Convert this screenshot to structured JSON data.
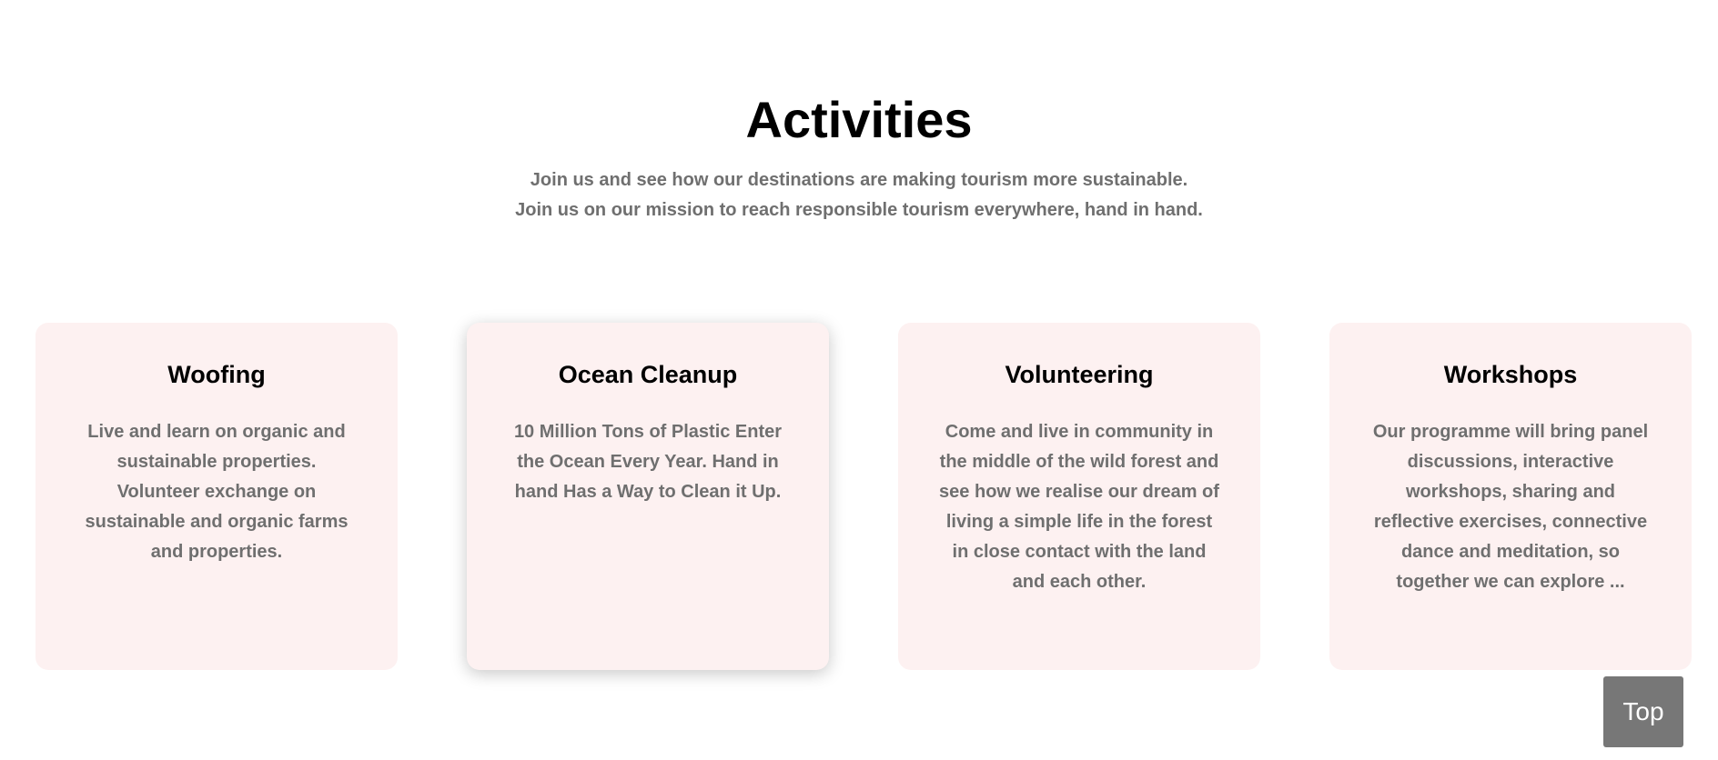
{
  "section": {
    "title": "Activities",
    "subtitle_line1": "Join us and see how our destinations are making tourism more sustainable.",
    "subtitle_line2": "Join us on our mission to reach responsible tourism everywhere, hand in hand."
  },
  "cards": [
    {
      "title": "Woofing",
      "text": "Live and learn on organic and sustainable properties. Volunteer exchange on sustainable and organic farms and properties."
    },
    {
      "title": "Ocean Cleanup",
      "text": "10 Million Tons of Plastic Enter the Ocean Every Year. Hand in hand Has a Way to Clean it Up."
    },
    {
      "title": "Volunteering",
      "text": "Come and live in community in the middle of the wild forest and see how we realise our dream of living a simple life in the forest in close contact with the land and each other."
    },
    {
      "title": "Workshops",
      "text": "Our programme will bring panel discussions, interactive workshops, sharing and reflective exercises, connective dance and meditation, so together we can explore ..."
    }
  ],
  "top_button": {
    "label": "Top"
  },
  "colors": {
    "card_background": "#fdf1f1",
    "muted_text": "#6f6f6f",
    "top_button_background": "#777777"
  }
}
